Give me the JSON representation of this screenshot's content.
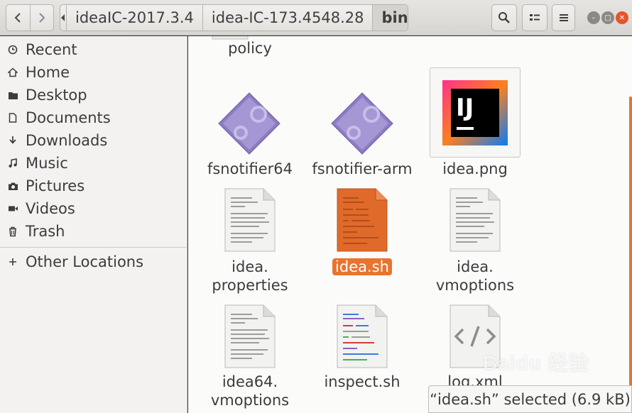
{
  "header": {
    "path": [
      "ideaIC-2017.3.4",
      "idea-IC-173.4548.28",
      "bin"
    ]
  },
  "sidebar": {
    "items": [
      {
        "label": "Recent",
        "icon": "clock-icon"
      },
      {
        "label": "Home",
        "icon": "home-icon"
      },
      {
        "label": "Desktop",
        "icon": "folder-icon"
      },
      {
        "label": "Documents",
        "icon": "document-icon"
      },
      {
        "label": "Downloads",
        "icon": "download-icon"
      },
      {
        "label": "Music",
        "icon": "music-icon"
      },
      {
        "label": "Pictures",
        "icon": "camera-icon"
      },
      {
        "label": "Videos",
        "icon": "video-icon"
      },
      {
        "label": "Trash",
        "icon": "trash-icon"
      }
    ],
    "other_locations": "Other Locations"
  },
  "files": {
    "policy": "policy",
    "fsnotifier64": "fsnotifier64",
    "fsnotifier_arm": "fsnotifier-arm",
    "idea_png": "idea.png",
    "idea_properties_1": "idea.",
    "idea_properties_2": "properties",
    "idea_sh": "idea.sh",
    "idea_vmoptions_1": "idea.",
    "idea_vmoptions_2": "vmoptions",
    "idea64_vmoptions_1": "idea64.",
    "idea64_vmoptions_2": "vmoptions",
    "inspect_sh": "inspect.sh",
    "log_xml": "log.xml"
  },
  "ij_logo": "IJ",
  "status": "“idea.sh” selected (6.9 kB)",
  "watermark": "Baidu 经验",
  "colors": {
    "accent": "#e8742f"
  }
}
